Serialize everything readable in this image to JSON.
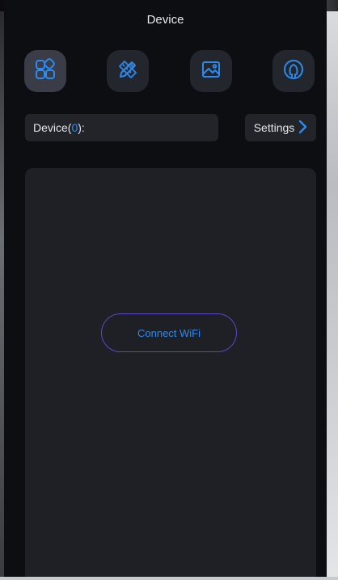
{
  "header": {
    "title": "Device"
  },
  "nav_icons": [
    {
      "name": "grid-icon",
      "active": true
    },
    {
      "name": "pencil-ruler-icon",
      "active": false
    },
    {
      "name": "image-icon",
      "active": false
    },
    {
      "name": "user-icon",
      "active": false
    }
  ],
  "device_bar": {
    "label_prefix": "Device(",
    "count": "0",
    "label_suffix": "):"
  },
  "settings": {
    "label": "Settings",
    "icon": "chevron-right-icon"
  },
  "main": {
    "connect_label": "Connect WiFi"
  },
  "colors": {
    "accent_blue": "#2c8bf0",
    "button_border": "#5a48c8",
    "background": "#0d0e12",
    "panel": "#1f2026"
  }
}
